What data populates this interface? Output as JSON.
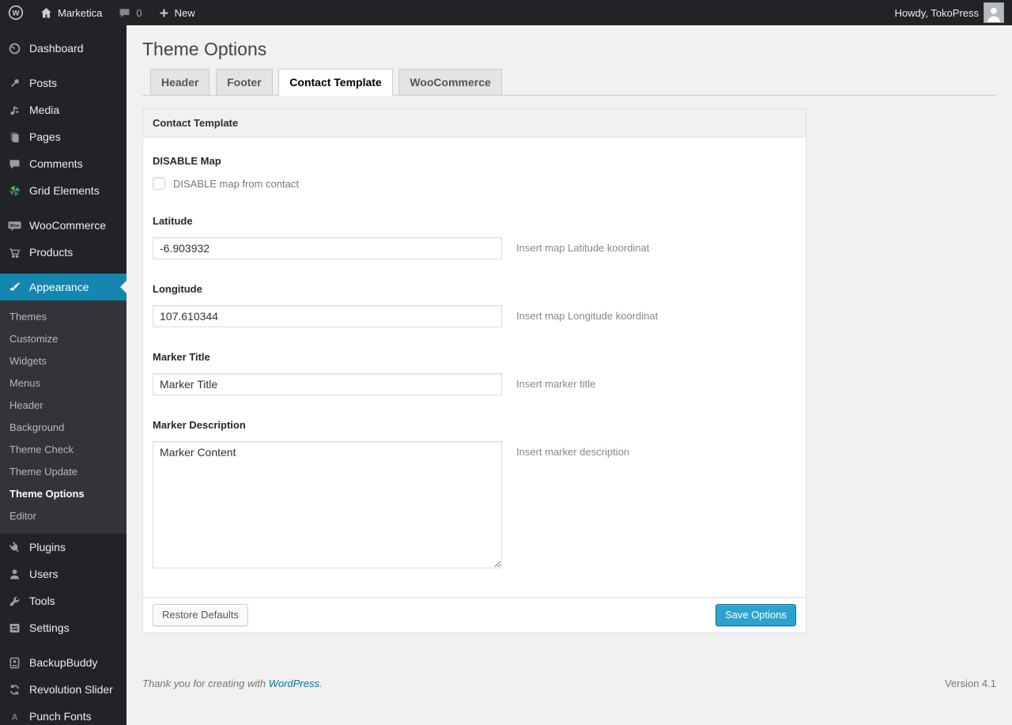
{
  "admin_bar": {
    "site_name": "Marketica",
    "comment_count": "0",
    "new_label": "New",
    "howdy": "Howdy, TokoPress"
  },
  "icons": {
    "wp_logo_glyph": "W",
    "woo_badge_glyph": "Woo",
    "punch_fonts_glyph": "A",
    "names": [
      "wordpress-logo",
      "home-icon",
      "comment-bubble-icon",
      "plus-icon",
      "dashboard-gauge-icon",
      "pin-icon",
      "media-note-icon",
      "pages-icon",
      "comments-icon",
      "grid-elements-icon",
      "woo-badge-icon",
      "cart-icon",
      "brush-icon",
      "plug-icon",
      "user-icon",
      "wrench-icon",
      "settings-icon",
      "backup-drive-icon",
      "rotate-arrows-icon",
      "letter-a-icon"
    ]
  },
  "sidebar": {
    "items": [
      {
        "label": "Dashboard"
      },
      {
        "label": "Posts"
      },
      {
        "label": "Media"
      },
      {
        "label": "Pages"
      },
      {
        "label": "Comments"
      },
      {
        "label": "Grid Elements"
      },
      {
        "label": "WooCommerce"
      },
      {
        "label": "Products"
      },
      {
        "label": "Appearance",
        "active": true
      },
      {
        "label": "Plugins"
      },
      {
        "label": "Users"
      },
      {
        "label": "Tools"
      },
      {
        "label": "Settings"
      },
      {
        "label": "BackupBuddy"
      },
      {
        "label": "Revolution Slider"
      },
      {
        "label": "Punch Fonts"
      }
    ],
    "appearance_submenu": [
      {
        "label": "Themes"
      },
      {
        "label": "Customize"
      },
      {
        "label": "Widgets"
      },
      {
        "label": "Menus"
      },
      {
        "label": "Header"
      },
      {
        "label": "Background"
      },
      {
        "label": "Theme Check"
      },
      {
        "label": "Theme Update"
      },
      {
        "label": "Theme Options",
        "current": true
      },
      {
        "label": "Editor"
      }
    ]
  },
  "main": {
    "page_title": "Theme Options",
    "tabs": [
      {
        "label": "Header",
        "active": false
      },
      {
        "label": "Footer",
        "active": false
      },
      {
        "label": "Contact Template",
        "active": true
      },
      {
        "label": "WooCommerce",
        "active": false
      }
    ],
    "panel": {
      "title": "Contact Template",
      "disable_map": {
        "label": "DISABLE Map",
        "checkbox_label": "DISABLE map from contact",
        "checked": false
      },
      "latitude": {
        "label": "Latitude",
        "value": "-6.903932",
        "hint": "Insert map Latitude koordinat"
      },
      "longitude": {
        "label": "Longitude",
        "value": "107.610344",
        "hint": "Insert map Longitude koordinat"
      },
      "marker_title": {
        "label": "Marker Title",
        "value": "Marker Title",
        "hint": "Insert marker title"
      },
      "marker_description": {
        "label": "Marker Description",
        "value": "Marker Content",
        "hint": "Insert marker description"
      },
      "restore_button": "Restore Defaults",
      "save_button": "Save Options"
    }
  },
  "footer": {
    "thanks_prefix": "Thank you for creating with ",
    "wordpress_link": "WordPress",
    "thanks_suffix": ".",
    "version": "Version 4.1"
  },
  "colors": {
    "admin_bar_bg": "#222326",
    "menu_highlight": "#1486af",
    "button_primary": "#2ea2cc",
    "button_primary_border": "#0074a2",
    "link": "#0074a2",
    "page_bg": "#f1f1f1"
  }
}
